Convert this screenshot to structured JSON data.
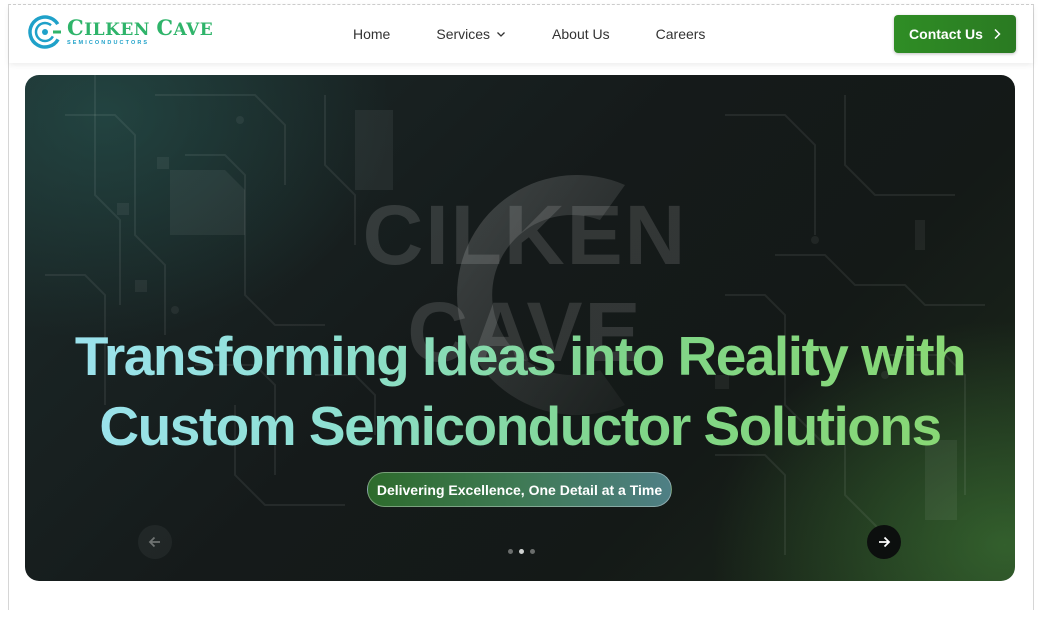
{
  "brand": {
    "name_first_cap": "C",
    "name_first_rest": "ILKEN",
    "name_second_cap": "C",
    "name_second_rest": "AVE",
    "subtitle": "SEMICONDUCTORS",
    "primary_color": "#2fb46a",
    "secondary_color": "#1fa1c9"
  },
  "nav": {
    "items": [
      {
        "label": "Home"
      },
      {
        "label": "Services",
        "has_dropdown": true
      },
      {
        "label": "About Us"
      },
      {
        "label": "Careers"
      }
    ],
    "contact_label": "Contact Us",
    "contact_color": "#2f8d25"
  },
  "hero": {
    "watermark": "CILKEN CAVE",
    "headline_line1": "Transforming Ideas into Reality with",
    "headline_line2": "Custom Semiconductor Solutions",
    "tagline": "Delivering Excellence, One Detail at a Time",
    "slide_count": 3,
    "active_slide": 2,
    "icons": {
      "prev": "arrow-left-icon",
      "next": "arrow-right-icon"
    }
  }
}
